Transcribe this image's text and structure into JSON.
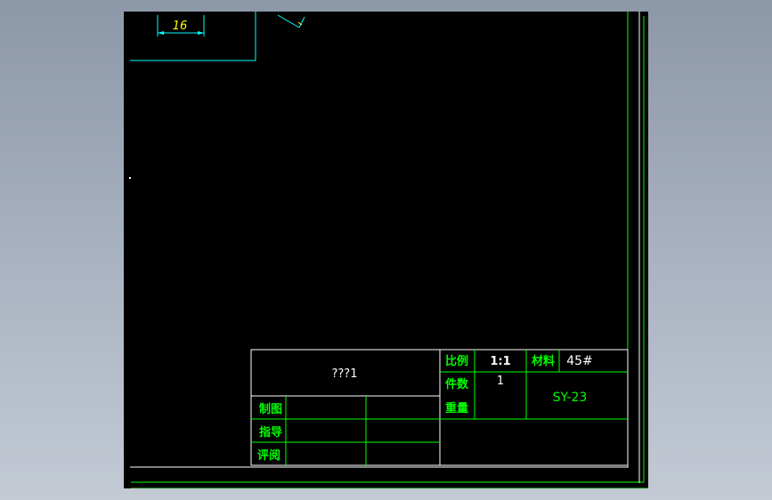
{
  "colors": {
    "background_gradient_top": "#8c97a8",
    "background_gradient_bottom": "#c3cad4",
    "viewport_bg": "#000000",
    "frame_line": "#ffffff",
    "border_line": "#00ff00",
    "table_line": "#00ff00",
    "label_text": "#00ff00",
    "value_text": "#ffffff",
    "dimension": "#00ffff",
    "dimension_text": "#ffff00"
  },
  "drawing": {
    "dimension_value": "16"
  },
  "title_block": {
    "part_name": "???1",
    "scale_label": "比例",
    "scale_value": "1:1",
    "material_label": "材料",
    "material_value": "45#",
    "quantity_label": "件数",
    "quantity_value": "1",
    "weight_label": "重量",
    "drawing_number": "SY-23",
    "drawn_by_label": "制图",
    "instructor_label": "指导",
    "reviewer_label": "评阅"
  }
}
